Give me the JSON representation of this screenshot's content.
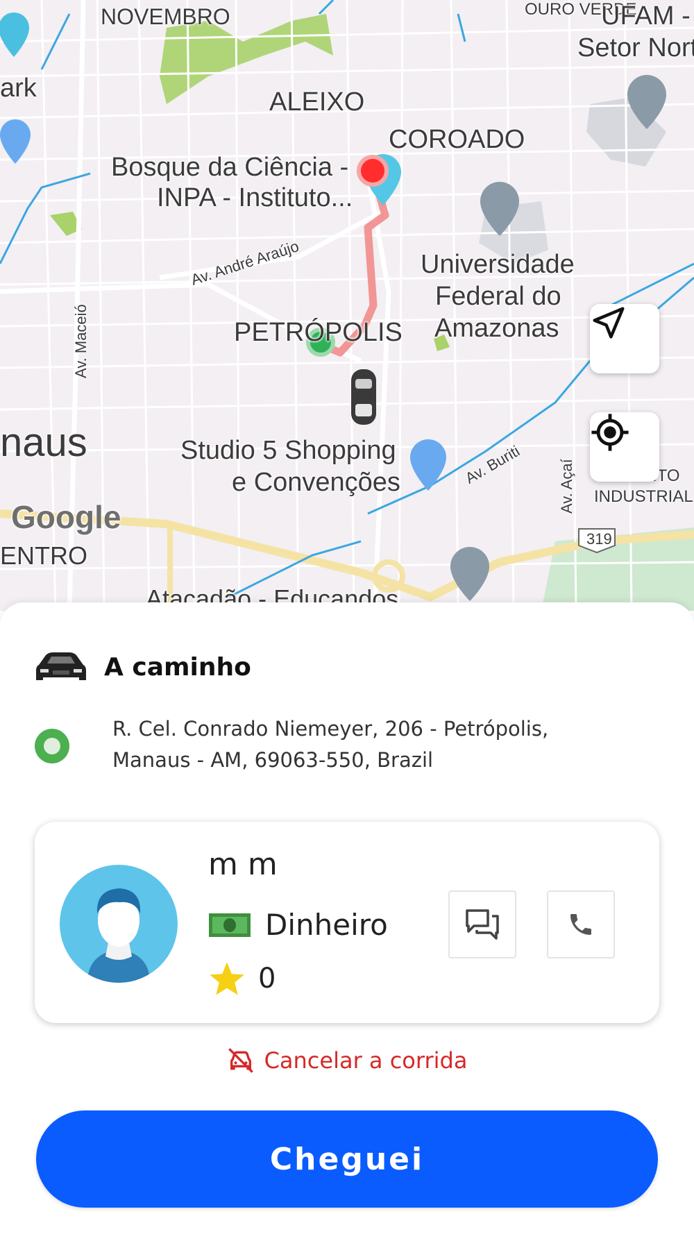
{
  "map": {
    "labels": {
      "novembro": "NOVEMBRO",
      "ouro_verde": "OURO VERDE",
      "ufam": "UFAM -",
      "setor_norte": "Setor Nort",
      "park": "ark",
      "aleixo": "ALEIXO",
      "coroado": "COROADO",
      "bosque_1": "Bosque da Ciência -",
      "bosque_2": "INPA - Instituto...",
      "av_andre_araujo": "Av. André Araújo",
      "universidade_1": "Universidade",
      "universidade_2": "Federal do",
      "universidade_3": "Amazonas",
      "av_maceio": "Av. Maceió",
      "petropolis": "PETRÓPOLIS",
      "manaus": "naus",
      "studio_1": "Studio 5 Shopping",
      "studio_2": "e Convenções",
      "av_buriti": "Av. Buriti",
      "av_acai": "Av. Açaí",
      "distrito": "ITO",
      "industrial": "INDUSTRIAL",
      "centro": "ENTRO",
      "route_number": "319",
      "atacadao": "Atacadão - Educandos",
      "google": "Google"
    },
    "route_color": "#f28b8b",
    "origin_marker_color": "#2fb157",
    "destination_marker_color": "#ff2d2d",
    "icons": {
      "send": "navigation-arrow-icon",
      "locate": "my-location-icon"
    }
  },
  "ride": {
    "status": "A caminho",
    "status_icon": "car-icon",
    "address_line1": "R. Cel. Conrado Niemeyer, 206 - Petrópolis,",
    "address_line2": "Manaus - AM, 69063-550, Brazil"
  },
  "passenger": {
    "name": "m m",
    "payment_method": "Dinheiro",
    "payment_icon": "cash-icon",
    "rating": "0",
    "rating_icon": "star-icon",
    "chat_icon": "chat-icon",
    "call_icon": "phone-icon"
  },
  "actions": {
    "cancel_label": "Cancelar a corrida",
    "cancel_icon": "cancel-car-icon",
    "primary_label": "Cheguei",
    "primary_color": "#0a5cff"
  }
}
